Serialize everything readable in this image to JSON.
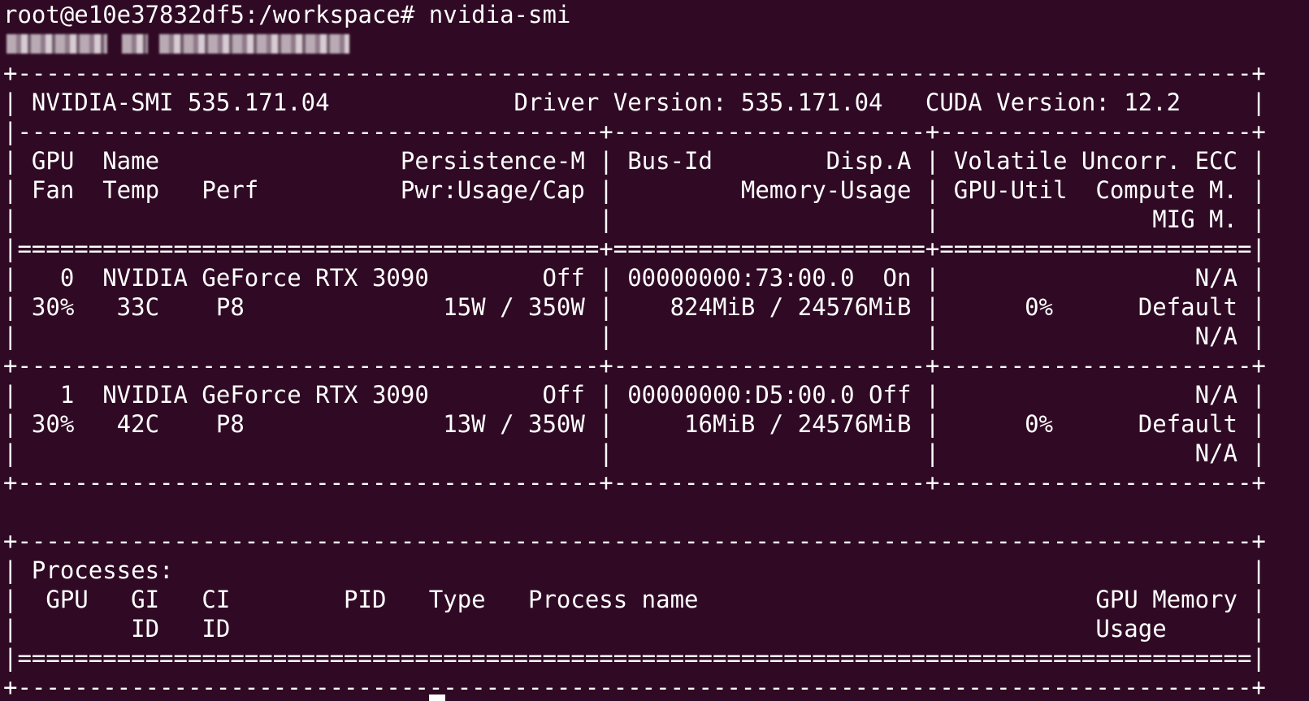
{
  "terminal": {
    "prompt": "root@e10e37832df5:/workspace# ",
    "command": "nvidia-smi",
    "border_top": "+---------------------------------------------------------------------------------------+",
    "header_line": "| NVIDIA-SMI 535.171.04             Driver Version: 535.171.04   CUDA Version: 12.2     |",
    "sep_dash": "|-----------------------------------------+----------------------+----------------------+",
    "col_header_1": "| GPU  Name                 Persistence-M | Bus-Id        Disp.A | Volatile Uncorr. ECC |",
    "col_header_2": "| Fan  Temp   Perf          Pwr:Usage/Cap |         Memory-Usage | GPU-Util  Compute M. |",
    "col_header_3": "|                                         |                      |               MIG M. |",
    "sep_equal": "|=========================================+======================+======================|",
    "gpu0_line1": "|   0  NVIDIA GeForce RTX 3090        Off | 00000000:73:00.0  On |                  N/A |",
    "gpu0_line2": "| 30%   33C    P8              15W / 350W |    824MiB / 24576MiB |      0%      Default |",
    "gpu0_line3": "|                                         |                      |                  N/A |",
    "row_sep": "+-----------------------------------------+----------------------+----------------------+",
    "gpu1_line1": "|   1  NVIDIA GeForce RTX 3090        Off | 00000000:D5:00.0 Off |                  N/A |",
    "gpu1_line2": "| 30%   42C    P8              13W / 350W |     16MiB / 24576MiB |      0%      Default |",
    "gpu1_line3": "|                                         |                      |                  N/A |",
    "row_sep_end": "+-----------------------------------------+----------------------+----------------------+",
    "blank": "",
    "proc_border_top": "+---------------------------------------------------------------------------------------+",
    "proc_title": "| Processes:                                                                            |",
    "proc_header_1": "|  GPU   GI   CI        PID   Type   Process name                            GPU Memory |",
    "proc_header_2": "|        ID   ID                                                             Usage      |",
    "proc_sep_equal": "|=======================================================================================|",
    "proc_border_bottom": "+---------------------------------------------------------------------------------------+"
  },
  "gpus": [
    {
      "index": "0",
      "name": "NVIDIA GeForce RTX 3090",
      "persistence": "Off",
      "bus_id": "00000000:73:00.0",
      "disp": "On",
      "fan": "30%",
      "temp": "33C",
      "perf": "P8",
      "power": "15W / 350W",
      "memory": "824MiB / 24576MiB",
      "util": "0%",
      "compute": "Default",
      "ecc": "N/A",
      "mig": "N/A"
    },
    {
      "index": "1",
      "name": "NVIDIA GeForce RTX 3090",
      "persistence": "Off",
      "bus_id": "00000000:D5:00.0",
      "disp": "Off",
      "fan": "30%",
      "temp": "42C",
      "perf": "P8",
      "power": "13W / 350W",
      "memory": "16MiB / 24576MiB",
      "util": "0%",
      "compute": "Default",
      "ecc": "N/A",
      "mig": "N/A"
    }
  ],
  "versions": {
    "nvidia_smi": "535.171.04",
    "driver": "535.171.04",
    "cuda": "12.2"
  },
  "colors": {
    "background": "#300a24",
    "foreground": "#ffffff"
  }
}
